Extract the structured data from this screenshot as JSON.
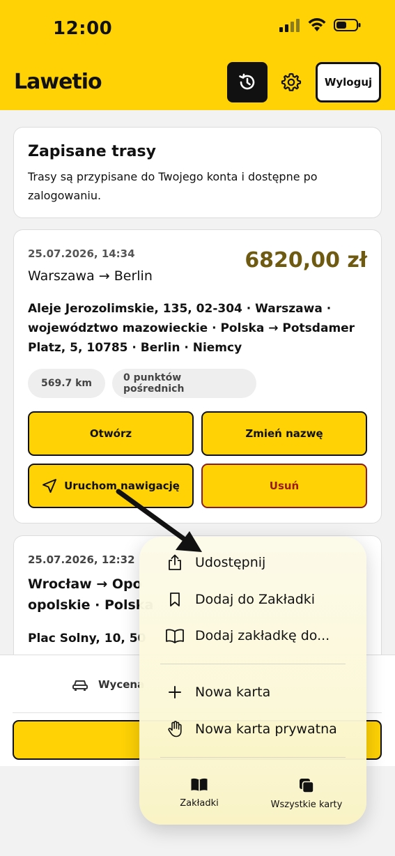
{
  "status_bar": {
    "time": "12:00"
  },
  "header": {
    "app_title": "Lawetio",
    "logout_label": "Wyloguj"
  },
  "info_card": {
    "title": "Zapisane trasy",
    "description": "Trasy są przypisane do Twojego konta i dostępne po zalogowaniu."
  },
  "route1": {
    "date": "25.07.2026, 14:34",
    "price": "6820,00 zł",
    "cities": "Warszawa → Berlin",
    "address": "Aleje Jerozolimskie, 135, 02-304 · Warszawa · województwo mazowieckie · Polska → Potsdamer Platz, 5, 10785 · Berlin · Niemcy",
    "distance": "569.7 km",
    "waypoints": "0 punktów pośrednich",
    "open_label": "Otwórz",
    "rename_label": "Zmień nazwę",
    "navigate_label": "Uruchom nawigację",
    "delete_label": "Usuń"
  },
  "route2": {
    "date": "25.07.2026, 12:32",
    "title_line1": "Wrocław → Opo",
    "title_line2": "opolskie · Polska",
    "address": "Plac Solny, 10, 50"
  },
  "bottom_bar": {
    "tab_label": "Wycena"
  },
  "context_menu": {
    "items": [
      {
        "label": "Udostępnij",
        "icon": "share-icon"
      },
      {
        "label": "Dodaj do Zakładki",
        "icon": "bookmark-icon"
      },
      {
        "label": "Dodaj zakładkę do...",
        "icon": "book-open-icon"
      },
      {
        "label": "Nowa karta",
        "icon": "plus-icon"
      },
      {
        "label": "Nowa karta prywatna",
        "icon": "hand-icon"
      }
    ],
    "footer": [
      {
        "label": "Zakładki",
        "icon": "bookmarks-book-icon"
      },
      {
        "label": "Wszystkie karty",
        "icon": "tabs-icon"
      }
    ]
  },
  "colors": {
    "accent": "#fed205",
    "price": "#6e5a10",
    "danger": "#9a1a1a"
  }
}
